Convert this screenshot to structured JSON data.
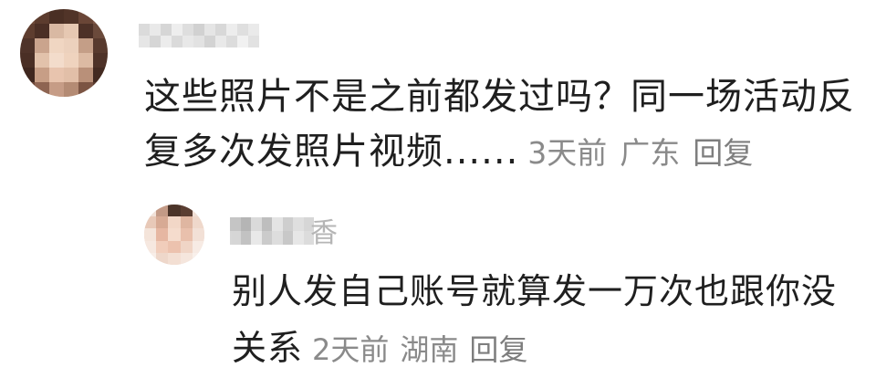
{
  "comment": {
    "username_blurred": true,
    "text_line1": "这些照片不是之前都发过吗？同一场活动反",
    "text_line2": "复多次发照片视频......",
    "time": "3天前",
    "location": "广东",
    "reply_label": "回复"
  },
  "reply": {
    "username_visible_char": "香",
    "text_line1": "别人发自己账号就算发一万次也跟你没",
    "text_line2": "关系",
    "time": "2天前",
    "location": "湖南",
    "reply_label": "回复"
  },
  "colors": {
    "text_primary": "#1f1f1f",
    "text_meta": "#8a8a8a",
    "background": "#ffffff"
  }
}
